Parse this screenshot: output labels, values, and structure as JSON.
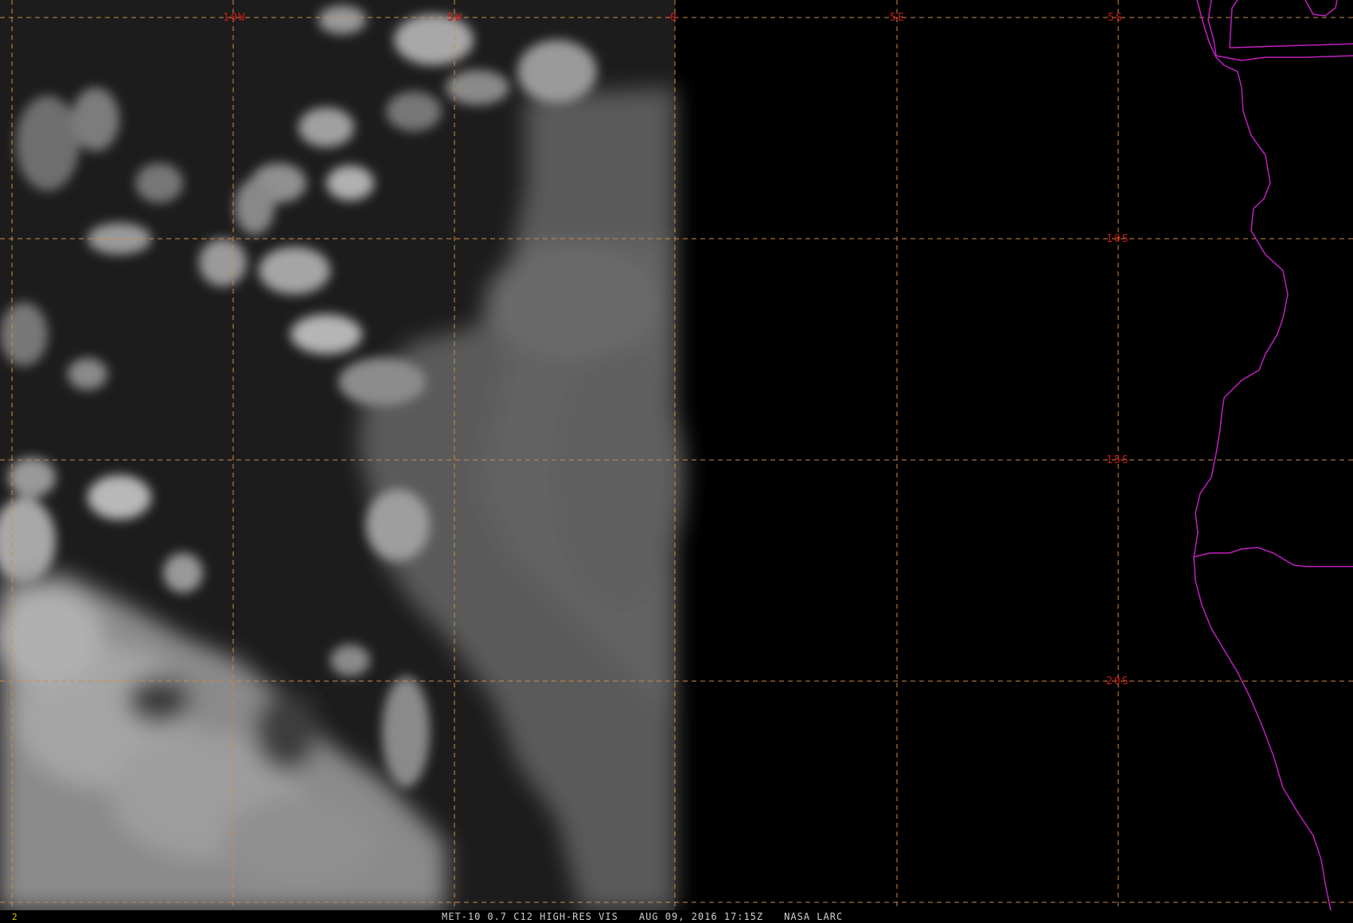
{
  "image": {
    "satellite": "MET-10",
    "product": "0.7 C12 HIGH-RES VIS",
    "datetime": "AUG 09, 2016 17:15Z",
    "source": "NASA LARC",
    "frame": "2"
  },
  "grid": {
    "longitude_labels": [
      "10W",
      "5W",
      "0",
      "5E"
    ],
    "latitude_labels": [
      "5S",
      "10S",
      "15S",
      "20S"
    ]
  },
  "colors": {
    "background": "#000000",
    "gridline": "#d08a48",
    "grid_label": "#d01818",
    "coastline": "#c020c0",
    "caption_text": "#cfcfcf",
    "frame_number": "#e0d000"
  }
}
